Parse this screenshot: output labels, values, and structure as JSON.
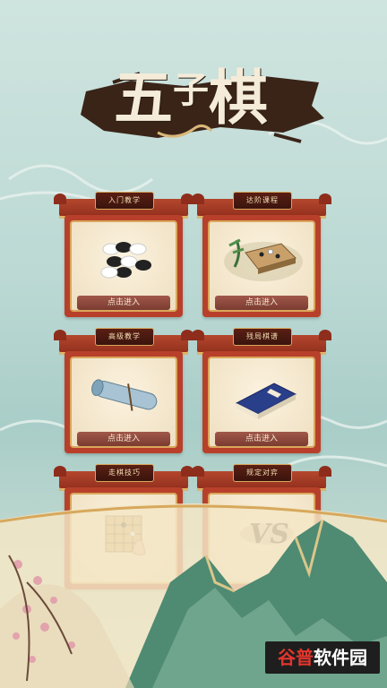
{
  "title": {
    "char1": "五",
    "char2": "子",
    "char3": "棋"
  },
  "cards": [
    {
      "caption": "入门教学",
      "button": "点击进入"
    },
    {
      "caption": "达阶课程",
      "button": "点击进入"
    },
    {
      "caption": "高级教学",
      "button": "点击进入"
    },
    {
      "caption": "残局棋谱",
      "button": "点击进入"
    },
    {
      "caption": "走棋技巧",
      "button": ""
    },
    {
      "caption": "规定对弈",
      "button": ""
    }
  ],
  "watermark": {
    "part1": "谷普",
    "part2": "软件园"
  }
}
